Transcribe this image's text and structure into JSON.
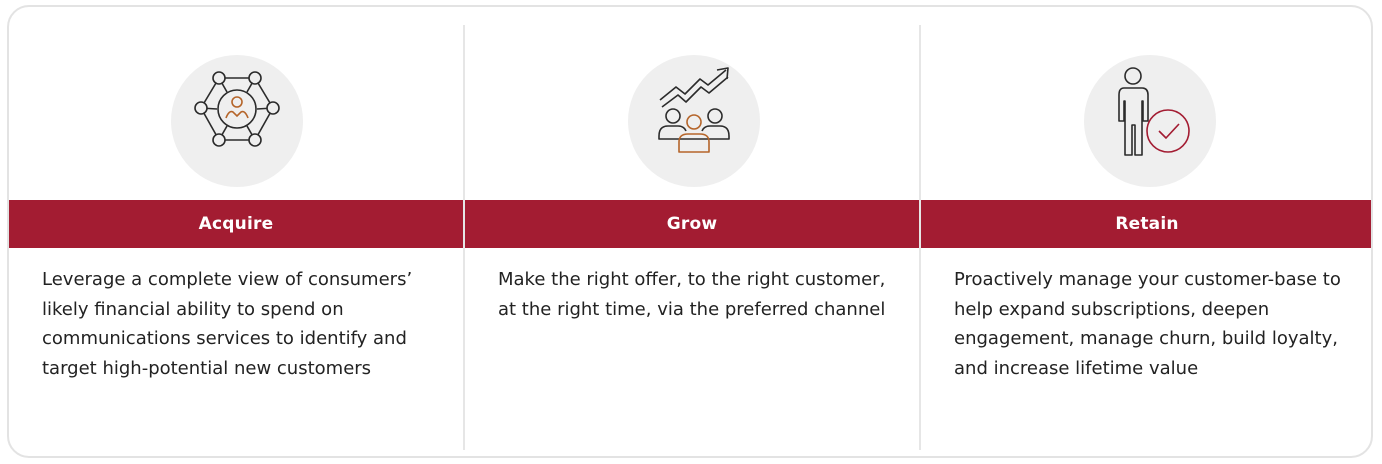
{
  "colors": {
    "band": "#a31c32",
    "icon_background": "#efefef",
    "icon_stroke": "#2b2b2b",
    "icon_accent_orange": "#b5652a",
    "icon_accent_red": "#a31c32"
  },
  "columns": [
    {
      "icon": "network-person-icon",
      "title": "Acquire",
      "description": "Leverage a complete view of consumers’ likely financial ability to spend on communications services to identify and target high-potential new customers"
    },
    {
      "icon": "growth-group-icon",
      "title": "Grow",
      "description": "Make the right offer, to the right customer, at the right time, via the preferred channel"
    },
    {
      "icon": "person-check-icon",
      "title": "Retain",
      "description": "Proactively manage your customer-base to help expand subscriptions, deepen engagement, manage churn, build loyalty, and increase lifetime value"
    }
  ]
}
